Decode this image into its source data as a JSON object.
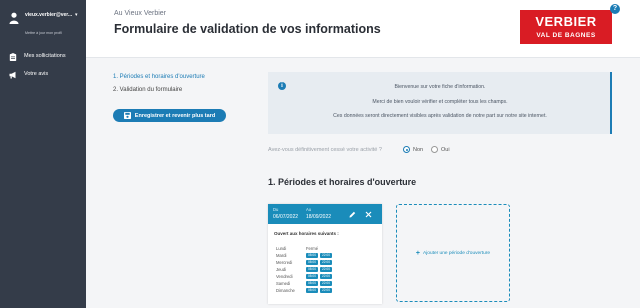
{
  "user": {
    "name": "vieux.verbier@ver...",
    "subtitle": "Mettre à jour mon profil"
  },
  "sidebar": {
    "items": [
      {
        "label": "Mes sollicitations",
        "icon": "clipboard-icon"
      },
      {
        "label": "Votre avis",
        "icon": "megaphone-icon"
      }
    ]
  },
  "header": {
    "subtitle": "Au Vieux Verbier",
    "title": "Formulaire de validation de vos informations",
    "logo_main": "VERBIER",
    "logo_sub": "VAL DE BAGNES",
    "help_label": "?"
  },
  "steps": [
    "1. Périodes et horaires d'ouverture",
    "2. Validation du formulaire"
  ],
  "save_button": "Enregistrer et revenir plus tard",
  "info": {
    "icon_label": "i",
    "lines": [
      "Bienvenue sur votre fiche d'information.",
      "Merci de bien vouloir vérifier et compléter tous les champs.",
      "Ces données seront directement visibles après validation de notre part sur notre site internet."
    ]
  },
  "question": {
    "text": "Avez-vous définitivement cessé votre activité ?",
    "options": [
      {
        "label": "Non",
        "selected": true
      },
      {
        "label": "Oui",
        "selected": false
      }
    ]
  },
  "section_title": "1. Périodes et horaires d'ouverture",
  "period": {
    "from_label": "Du",
    "from_date": "06/07/2022",
    "to_label": "Au",
    "to_date": "18/09/2022",
    "open_label": "Ouvert aux horaires suivants :",
    "days": [
      {
        "name": "Lundi",
        "closed": "Fermé",
        "times": []
      },
      {
        "name": "Mardi",
        "closed": "",
        "times": [
          "08:00",
          "22:00"
        ]
      },
      {
        "name": "Mercredi",
        "closed": "",
        "times": [
          "08:00",
          "22:00"
        ]
      },
      {
        "name": "Jeudi",
        "closed": "",
        "times": [
          "08:00",
          "22:00"
        ]
      },
      {
        "name": "Vendredi",
        "closed": "",
        "times": [
          "08:00",
          "22:00"
        ]
      },
      {
        "name": "Samedi",
        "closed": "",
        "times": [
          "08:00",
          "22:00"
        ]
      },
      {
        "name": "Dimanche",
        "closed": "",
        "times": [
          "08:00",
          "22:00"
        ]
      }
    ]
  },
  "add_period": {
    "plus": "+",
    "label": "Ajouter une période d'ouverture"
  },
  "colors": {
    "sidebar": "#343c49",
    "accent": "#1c7cb5",
    "brand_red": "#d91c24"
  }
}
